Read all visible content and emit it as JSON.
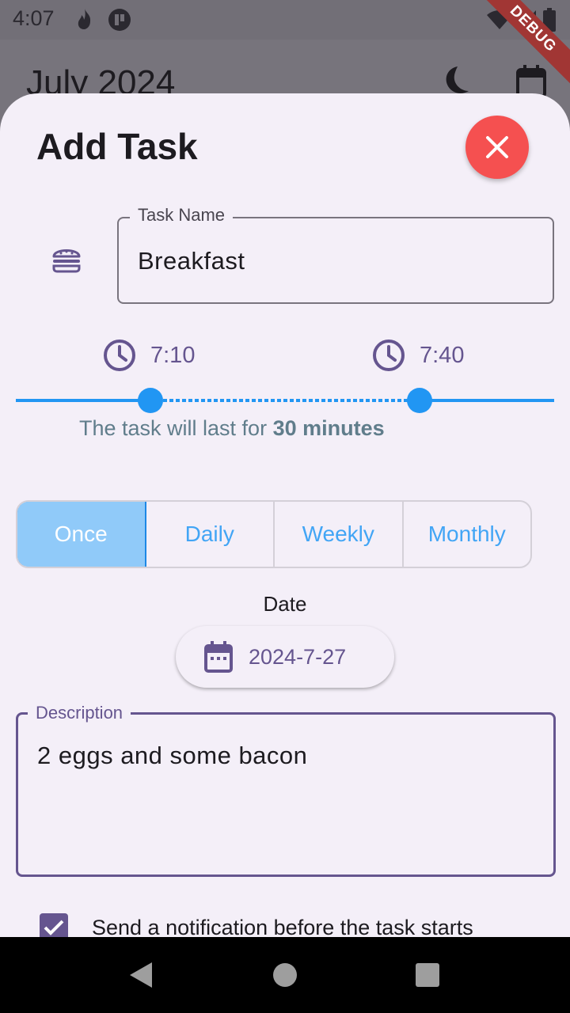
{
  "status_bar": {
    "time": "4:07",
    "icons": [
      "flame-icon",
      "app-icon",
      "wifi-icon",
      "signal-icon",
      "battery-icon"
    ]
  },
  "debug_banner": "DEBUG",
  "background_app": {
    "month_title": "July 2024",
    "icons": [
      "dark-mode-icon",
      "calendar-icon"
    ]
  },
  "sheet": {
    "title": "Add Task",
    "close_icon": "close-icon",
    "task_icon": "hamburger-icon",
    "task_name": {
      "label": "Task Name",
      "value": "Breakfast"
    },
    "start_time": "7:10",
    "end_time": "7:40",
    "time_range": {
      "start_fraction": 0.25,
      "end_fraction": 0.75
    },
    "duration": {
      "prefix": "The task will last for ",
      "value": "30 minutes"
    },
    "frequency": {
      "options": [
        "Once",
        "Daily",
        "Weekly",
        "Monthly"
      ],
      "selected": "Once"
    },
    "date": {
      "label": "Date",
      "value": "2024-7-27"
    },
    "description": {
      "label": "Description",
      "value": "2 eggs and some bacon"
    },
    "notification": {
      "checked": true,
      "label": "Send a notification before the task starts"
    }
  },
  "colors": {
    "accent": "#65558f",
    "slider": "#2196f3",
    "close": "#f55050",
    "selected_segment": "#90caf9"
  }
}
